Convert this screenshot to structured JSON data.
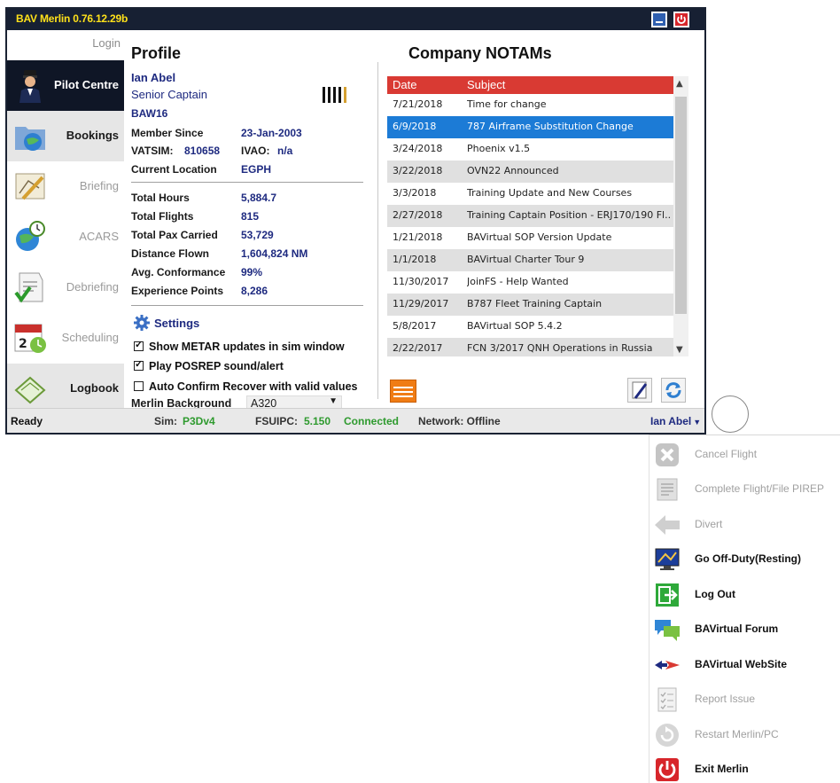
{
  "window": {
    "title": "BAV Merlin 0.76.12.29b"
  },
  "sidebar": {
    "login": "Login",
    "items": [
      {
        "label": "Pilot Centre",
        "state": "active",
        "icon": "pilot-icon"
      },
      {
        "label": "Bookings",
        "state": "enabled",
        "icon": "globe-folder-icon"
      },
      {
        "label": "Briefing",
        "state": "disabled",
        "icon": "chart-icon"
      },
      {
        "label": "ACARS",
        "state": "disabled",
        "icon": "globe-clock-icon"
      },
      {
        "label": "Debriefing",
        "state": "disabled",
        "icon": "clipboard-icon"
      },
      {
        "label": "Scheduling",
        "state": "disabled",
        "icon": "calendar-icon"
      },
      {
        "label": "Logbook",
        "state": "enabled",
        "icon": "logbook-icon"
      }
    ]
  },
  "profile": {
    "title": "Profile",
    "name": "Ian Abel",
    "rank": "Senior Captain",
    "callsign": "BAW16",
    "member_since_label": "Member Since",
    "member_since": "23-Jan-2003",
    "vatsim_label": "VATSIM:",
    "vatsim": "810658",
    "ivao_label": "IVAO:",
    "ivao": "n/a",
    "location_label": "Current Location",
    "location": "EGPH",
    "stats": [
      {
        "label": "Total Hours",
        "value": "5,884.7"
      },
      {
        "label": "Total Flights",
        "value": "815"
      },
      {
        "label": "Total Pax Carried",
        "value": "53,729"
      },
      {
        "label": "Distance Flown",
        "value": "1,604,824 NM"
      },
      {
        "label": "Avg. Conformance",
        "value": "99%"
      },
      {
        "label": "Experience Points",
        "value": "8,286"
      }
    ],
    "settings_label": "Settings",
    "checks": [
      {
        "label": "Show METAR updates in sim window",
        "checked": true
      },
      {
        "label": "Play POSREP sound/alert",
        "checked": true
      },
      {
        "label": "Auto Confirm Recover with valid values",
        "checked": false
      }
    ],
    "background_label": "Merlin Background",
    "background_value": "A320"
  },
  "notams": {
    "title": "Company NOTAMs",
    "col_date": "Date",
    "col_subject": "Subject",
    "rows": [
      {
        "date": "7/21/2018",
        "subject": "Time for change"
      },
      {
        "date": "6/9/2018",
        "subject": "787 Airframe Substitution Change"
      },
      {
        "date": "3/24/2018",
        "subject": "Phoenix v1.5"
      },
      {
        "date": "3/22/2018",
        "subject": "OVN22 Announced"
      },
      {
        "date": "3/3/2018",
        "subject": "Training Update and New Courses"
      },
      {
        "date": "2/27/2018",
        "subject": "Training Captain Position - ERJ170/190 Fl..."
      },
      {
        "date": "1/21/2018",
        "subject": "BAVirtual SOP Version Update"
      },
      {
        "date": "1/1/2018",
        "subject": "BAVirtual Charter Tour 9"
      },
      {
        "date": "11/30/2017",
        "subject": "JoinFS - Help Wanted"
      },
      {
        "date": "11/29/2017",
        "subject": "B787 Fleet Training Captain"
      },
      {
        "date": "5/8/2017",
        "subject": "BAVirtual SOP 5.4.2"
      },
      {
        "date": "2/22/2017",
        "subject": "FCN 3/2017 QNH Operations in Russia"
      }
    ],
    "selected_index": 1
  },
  "status": {
    "text": "Ready",
    "sim_label": "Sim:",
    "sim": "P3Dv4",
    "fsuipc_label": "FSUIPC:",
    "fsuipc": "5.150",
    "connected": "Connected",
    "network_label": "Network: Offline",
    "user": "Ian Abel"
  },
  "menu": {
    "items": [
      {
        "label": "Cancel Flight",
        "enabled": false,
        "icon": "cancel-icon"
      },
      {
        "label": "Complete Flight/File PIREP",
        "enabled": false,
        "icon": "pirep-icon"
      },
      {
        "label": "Divert",
        "enabled": false,
        "icon": "divert-arrow-icon"
      },
      {
        "label": "Go Off-Duty(Resting)",
        "enabled": true,
        "icon": "monitor-icon"
      },
      {
        "label": "Log Out",
        "enabled": true,
        "icon": "logout-icon"
      },
      {
        "label": "BAVirtual Forum",
        "enabled": true,
        "icon": "forum-chat-icon"
      },
      {
        "label": "BAVirtual WebSite",
        "enabled": true,
        "icon": "website-arrow-icon"
      },
      {
        "label": "Report Issue",
        "enabled": false,
        "icon": "report-checklist-icon"
      },
      {
        "label": "Restart Merlin/PC",
        "enabled": false,
        "icon": "restart-icon"
      },
      {
        "label": "Exit Merlin",
        "enabled": true,
        "icon": "power-icon"
      }
    ]
  },
  "colors": {
    "titlebar": "#172033",
    "title_text": "#ffe11a",
    "accent_blue": "#1e2a80",
    "notam_header": "#d93a33",
    "selection": "#1c7bd6",
    "status_green": "#2e9a2e"
  }
}
